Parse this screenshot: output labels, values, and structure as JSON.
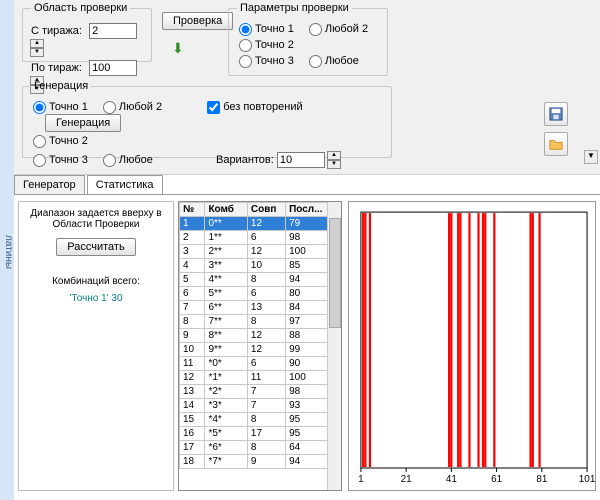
{
  "leftstrip_text": "латины",
  "region_check": {
    "legend": "Область проверки",
    "from_label": "С тиража:",
    "from_value": "2",
    "to_label": "По тираж:",
    "to_value": "100",
    "check_btn": "Проверка"
  },
  "params_check": {
    "legend": "Параметры проверки",
    "opts": [
      "Точно 1",
      "Любой 2",
      "Точно 2",
      "Точно 3",
      "Любое"
    ],
    "selected": 0
  },
  "generation": {
    "legend": "Генерация",
    "opts": [
      "Точно 1",
      "Любой 2",
      "Точно 2",
      "Точно 3",
      "Любое"
    ],
    "selected": 0,
    "no_repeat_label": "без повторений",
    "no_repeat_checked": true,
    "gen_btn": "Генерация",
    "variants_label": "Вариантов:",
    "variants_value": "10"
  },
  "tabs": {
    "gen": "Генератор",
    "stat": "Статистика"
  },
  "leftpanel": {
    "note": "Диапазон задается вверху в Области Проверки",
    "calc_btn": "Рассчитать",
    "comb_label": "Комбинаций всего:",
    "comb_value": "'Точно 1' 30"
  },
  "table": {
    "headers": [
      "№",
      "Комб",
      "Совп",
      "Посл..."
    ],
    "rows": [
      [
        1,
        "0**",
        12,
        79
      ],
      [
        2,
        "1**",
        6,
        98
      ],
      [
        3,
        "2**",
        12,
        100
      ],
      [
        4,
        "3**",
        10,
        85
      ],
      [
        5,
        "4**",
        8,
        94
      ],
      [
        6,
        "5**",
        6,
        80
      ],
      [
        7,
        "6**",
        13,
        84
      ],
      [
        8,
        "7**",
        8,
        97
      ],
      [
        9,
        "8**",
        12,
        88
      ],
      [
        10,
        "9**",
        12,
        99
      ],
      [
        11,
        "*0*",
        6,
        90
      ],
      [
        12,
        "*1*",
        11,
        100
      ],
      [
        13,
        "*2*",
        7,
        98
      ],
      [
        14,
        "*3*",
        7,
        93
      ],
      [
        15,
        "*4*",
        8,
        95
      ],
      [
        16,
        "*5*",
        17,
        95
      ],
      [
        17,
        "*6*",
        8,
        64
      ],
      [
        18,
        "*7*",
        9,
        94
      ]
    ],
    "selected_row": 1
  },
  "chart_data": {
    "type": "bar",
    "xlim": [
      1,
      101
    ],
    "ylim": [
      0,
      100
    ],
    "x_ticks": [
      1,
      21,
      41,
      61,
      81,
      101
    ],
    "values_x": [
      2,
      3,
      5,
      40,
      41,
      44,
      45,
      49,
      53,
      55,
      56,
      60,
      76,
      77,
      80
    ],
    "bar_color": "#ff0000"
  }
}
